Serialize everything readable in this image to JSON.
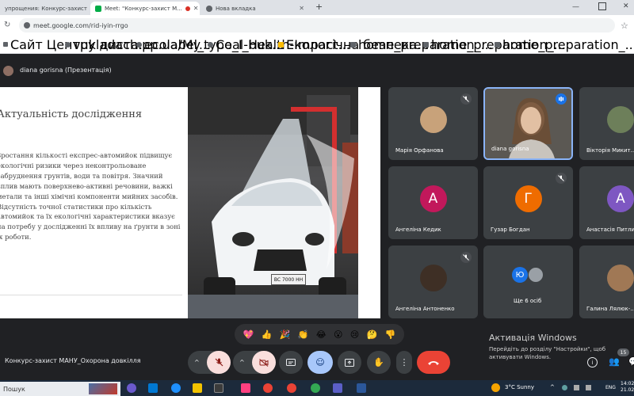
{
  "browser": {
    "tabs": [
      {
        "label": "упрощения: Конкурс-захист ",
        "active": false
      },
      {
        "label": "Meet: \"Конкурс-захист М...",
        "active": true
      },
      {
        "label": "Нова вкладка",
        "active": false
      }
    ],
    "new_tab": "+",
    "url": "meet.google.com/rid-iyin-rrgo",
    "bookmarks": [
      "Сайт Центру диста...",
      "vukladach.pp.ua/My...",
      "ecolabel_type_I_buk...",
      "Coal-Health-Impact...",
      "Екологічна безпека...",
      "home_preparation_...",
      "home_preparation_...",
      "home_preparation_..."
    ]
  },
  "meet": {
    "presenter_label": "diana gorisna (Презентація)",
    "slide": {
      "title": "Актуальність дослідження",
      "body": "Зростання кількості експрес-автомийок підвищує екологічні ризики через неконтрольоване забруднення грунтів, води та повітря. Значний вплив мають поверхнево-активні речовини, важкі метали та інші хімічні компоненти мийних засобів. Відсутність точної статистики про кількість автомийок та їх екологічні характеристики вказує на потребу у дослідженні їх впливу на ґрунти в зоні їх роботи.",
      "plate": "BC 7000 HH"
    },
    "participants": [
      {
        "name": "Марія Орфанова",
        "type": "photo"
      },
      {
        "name": "diana gorisna",
        "type": "video"
      },
      {
        "name": "Вікторія Микит...",
        "type": "photo"
      },
      {
        "name": "Ангеліна Кедик",
        "type": "letter",
        "letter": "А",
        "color": "#c2185b"
      },
      {
        "name": "Гузар Богдан",
        "type": "letter",
        "letter": "Г",
        "color": "#ef6c00"
      },
      {
        "name": "Анастасія Питли...",
        "type": "letter",
        "letter": "А",
        "color": "#7e57c2"
      },
      {
        "name": "Ангеліна Антоненко",
        "type": "photo"
      },
      {
        "name": "Ще 6 осіб",
        "type": "group",
        "letter": "Ю",
        "color": "#1a73e8"
      },
      {
        "name": "Галина Лялюк-...",
        "type": "photo"
      }
    ],
    "reactions": [
      "💖",
      "👍",
      "🎉",
      "👏",
      "😂",
      "😮",
      "😢",
      "🤔",
      "👎"
    ],
    "meeting_name": "Конкурс-захист МАНУ_Охорона довкілля",
    "participant_count": "15",
    "activation": {
      "title": "Активація Windows",
      "text": "Перейдіть до розділу \"Настройки\", щоб активувати Windows."
    }
  },
  "taskbar": {
    "search": "Пошук",
    "weather": "3°C  Sunny",
    "lang": "ENG",
    "time": "14:02",
    "date": "21.02"
  }
}
